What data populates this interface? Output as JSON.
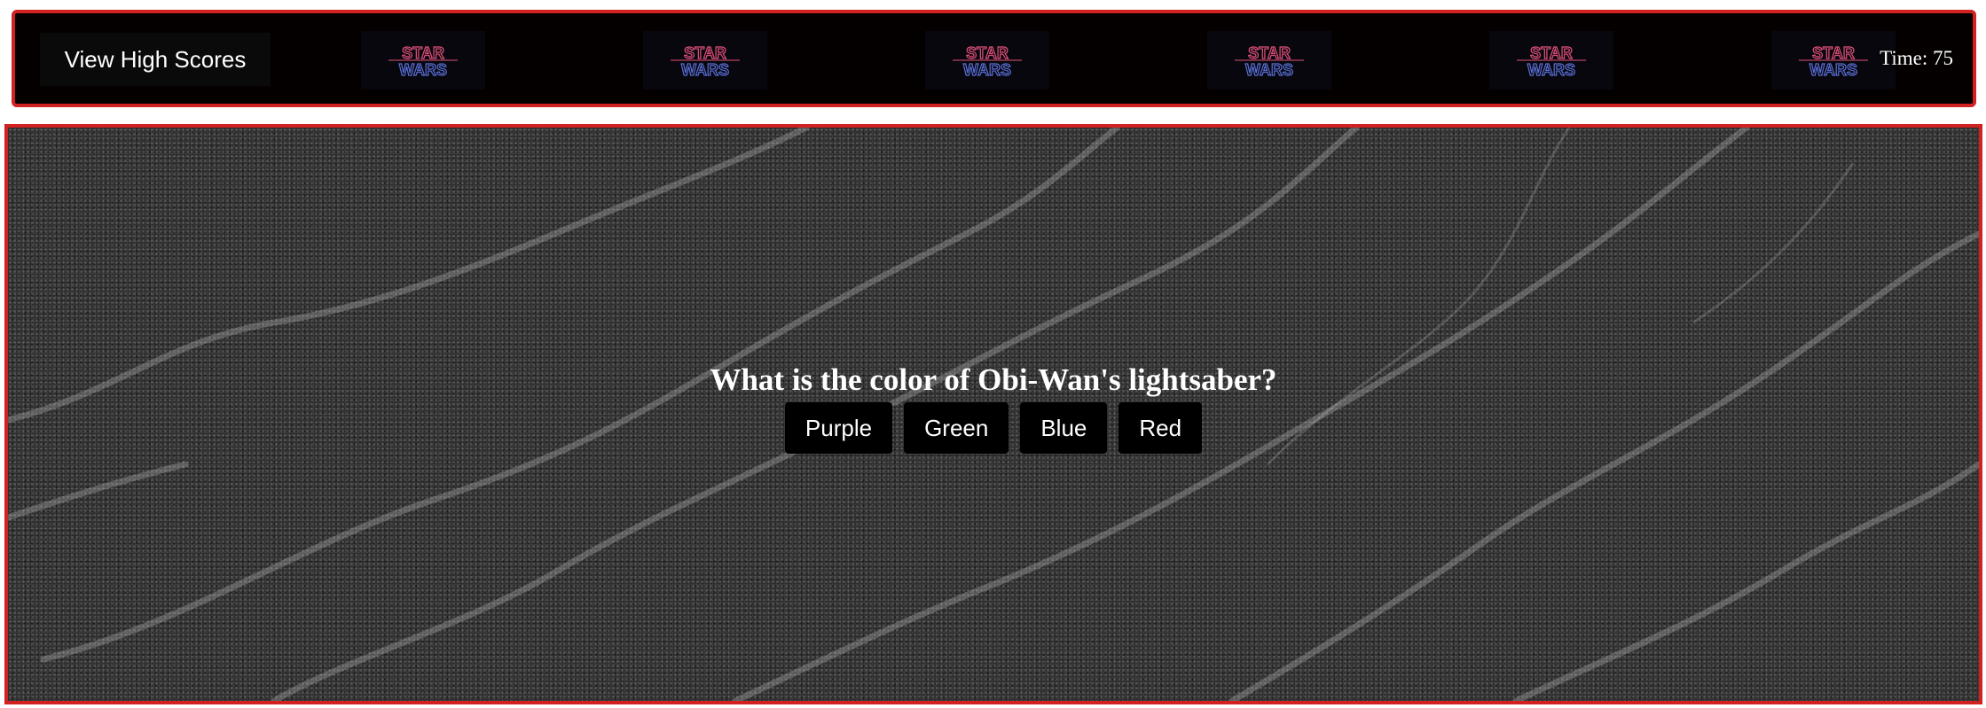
{
  "header": {
    "high_scores_label": "View High Scores",
    "logos": [
      {
        "icon": "star-wars-logo",
        "line1": "STAR",
        "line2": "WARS"
      },
      {
        "icon": "star-wars-logo",
        "line1": "STAR",
        "line2": "WARS"
      },
      {
        "icon": "star-wars-logo",
        "line1": "STAR",
        "line2": "WARS"
      },
      {
        "icon": "star-wars-logo",
        "line1": "STAR",
        "line2": "WARS"
      },
      {
        "icon": "star-wars-logo",
        "line1": "STAR",
        "line2": "WARS"
      },
      {
        "icon": "star-wars-logo",
        "line1": "STAR",
        "line2": "WARS"
      }
    ],
    "timer_text": "Time: 75"
  },
  "quiz": {
    "question": "What is the color of Obi-Wan's lightsaber?",
    "choices": [
      "Purple",
      "Green",
      "Blue",
      "Red"
    ]
  },
  "colors": {
    "border": "#d22121",
    "header_bg": "#050000",
    "logo_pink": "#e0507a",
    "logo_blue": "#5a6fd8",
    "button_bg": "#000000"
  }
}
